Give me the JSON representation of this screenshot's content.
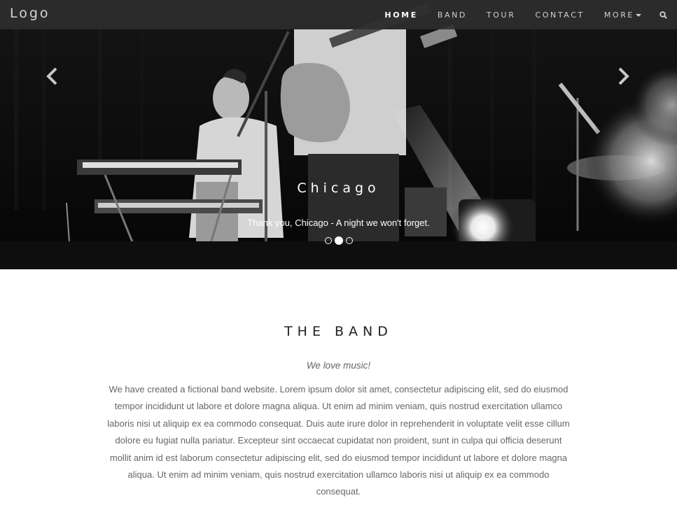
{
  "nav": {
    "logo": "Logo",
    "items": [
      {
        "label": "HOME",
        "active": true
      },
      {
        "label": "BAND",
        "active": false
      },
      {
        "label": "TOUR",
        "active": false
      },
      {
        "label": "CONTACT",
        "active": false
      },
      {
        "label": "MORE",
        "active": false,
        "has_dropdown": true
      }
    ],
    "search_icon": "search-icon"
  },
  "carousel": {
    "prev_icon": "chevron-left-icon",
    "next_icon": "chevron-right-icon",
    "caption_title": "Chicago",
    "caption_text": "Thank you, Chicago - A night we won't forget.",
    "slide_count": 3,
    "active_slide": 2
  },
  "band": {
    "title": "THE BAND",
    "subtitle": "We love music!",
    "body": "We have created a fictional band website. Lorem ipsum dolor sit amet, consectetur adipiscing elit, sed do eiusmod tempor incididunt ut labore et dolore magna aliqua. Ut enim ad minim veniam, quis nostrud exercitation ullamco laboris nisi ut aliquip ex ea commodo consequat. Duis aute irure dolor in reprehenderit in voluptate velit esse cillum dolore eu fugiat nulla pariatur. Excepteur sint occaecat cupidatat non proident, sunt in culpa qui officia deserunt mollit anim id est laborum consectetur adipiscing elit, sed do eiusmod tempor incididunt ut labore et dolore magna aliqua. Ut enim ad minim veniam, quis nostrud exercitation ullamco laboris nisi ut aliquip ex ea commodo consequat."
  },
  "colors": {
    "nav_bg": "#2e2e2e",
    "text_muted": "#666666",
    "heading": "#222222"
  }
}
